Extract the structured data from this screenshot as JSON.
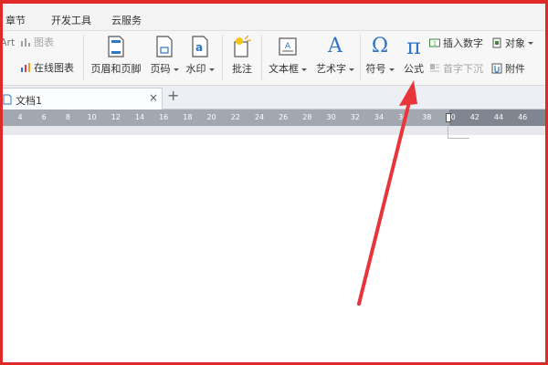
{
  "menu": {
    "tabs": [
      "章节",
      "开发工具",
      "云服务"
    ]
  },
  "ribbon": {
    "art_label": "Art",
    "chart_label": "图表",
    "online_chart_label": "在线图表",
    "header_footer_label": "页眉和页脚",
    "page_number_label": "页码",
    "watermark_label": "水印",
    "comment_label": "批注",
    "textbox_label": "文本框",
    "wordart_label": "艺术字",
    "symbol_label": "符号",
    "formula_label": "公式",
    "insert_number_label": "插入数字",
    "dropcap_label": "首字下沉",
    "object_label": "对象",
    "attachment_label": "附件",
    "symbol_glyph": "Ω",
    "formula_glyph": "π",
    "wordart_glyph": "A",
    "watermark_glyph": "a"
  },
  "document": {
    "tab_name": "文档1",
    "close_glyph": "×",
    "add_glyph": "+"
  },
  "ruler": {
    "ticks": [
      "4",
      "6",
      "8",
      "10",
      "12",
      "14",
      "16",
      "18",
      "20",
      "22",
      "24",
      "26",
      "28",
      "30",
      "32",
      "34",
      "36",
      "38",
      "40",
      "42",
      "44",
      "46"
    ]
  },
  "colors": {
    "highlight_border": "#e02a2a",
    "arrow": "#e8343a",
    "accent_blue": "#2e75c7"
  }
}
